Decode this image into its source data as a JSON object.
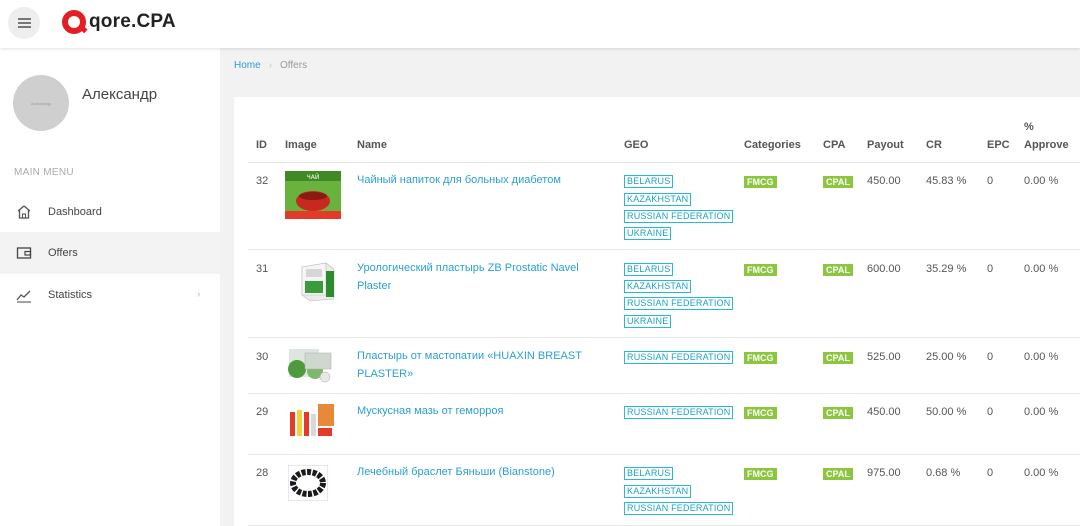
{
  "header": {
    "brand": "qore.CPA",
    "menu_icon": "hamburger-icon"
  },
  "sidebar": {
    "avatar_text": "Александр",
    "username": "Александр",
    "menu_title": "MAIN MENU",
    "items": [
      {
        "label": "Dashboard",
        "icon": "home-icon"
      },
      {
        "label": "Offers",
        "icon": "wallet-icon",
        "active": true
      },
      {
        "label": "Statistics",
        "icon": "chart-line-icon",
        "has_submenu": true
      }
    ]
  },
  "breadcrumb": {
    "home": "Home",
    "current": "Offers"
  },
  "table": {
    "columns": {
      "id": "ID",
      "image": "Image",
      "name": "Name",
      "geo": "GEO",
      "categories": "Categories",
      "cpa": "CPA",
      "payout": "Payout",
      "cr": "CR",
      "epc": "EPC",
      "approve_line1": "%",
      "approve_line2": "Approve"
    },
    "rows": [
      {
        "id": "32",
        "name_line1": "Чайный напиток для больных диабетом",
        "name_line2": "",
        "geo": [
          "BELARUS",
          "KAZAKHSTAN",
          "RUSSIAN FEDERATION",
          "UKRAINE"
        ],
        "category": "FMCG",
        "cpa": "CPAL",
        "payout": "450.00",
        "cr": "45.83 %",
        "epc": "0",
        "approve": "0.00 %",
        "image": "tea-drink-product-image"
      },
      {
        "id": "31",
        "name_line1": "Урологический пластырь ZB Prostatic Navel",
        "name_line2": "Plaster",
        "geo": [
          "BELARUS",
          "KAZAKHSTAN",
          "RUSSIAN FEDERATION",
          "UKRAINE"
        ],
        "category": "FMCG",
        "cpa": "CPAL",
        "payout": "600.00",
        "cr": "35.29 %",
        "epc": "0",
        "approve": "0.00 %",
        "image": "plaster-box-product-image"
      },
      {
        "id": "30",
        "name_line1": "Пластырь от мастопатии «HUAXIN BREAST",
        "name_line2": "PLASTER»",
        "geo": [
          "RUSSIAN FEDERATION"
        ],
        "category": "FMCG",
        "cpa": "CPAL",
        "payout": "525.00",
        "cr": "25.00 %",
        "epc": "0",
        "approve": "0.00 %",
        "image": "breast-plaster-product-image"
      },
      {
        "id": "29",
        "name_line1": "Мускусная мазь от геморроя",
        "name_line2": "",
        "geo": [
          "RUSSIAN FEDERATION"
        ],
        "category": "FMCG",
        "cpa": "CPAL",
        "payout": "450.00",
        "cr": "50.00 %",
        "epc": "0",
        "approve": "0.00 %",
        "image": "ointment-product-image"
      },
      {
        "id": "28",
        "name_line1": "Лечебный браслет Бяньши (Bianstone)",
        "name_line2": "",
        "geo": [
          "BELARUS",
          "KAZAKHSTAN",
          "RUSSIAN FEDERATION"
        ],
        "category": "FMCG",
        "cpa": "CPAL",
        "payout": "975.00",
        "cr": "0.68 %",
        "epc": "0",
        "approve": "0.00 %",
        "image": "bracelet-product-image"
      }
    ]
  }
}
